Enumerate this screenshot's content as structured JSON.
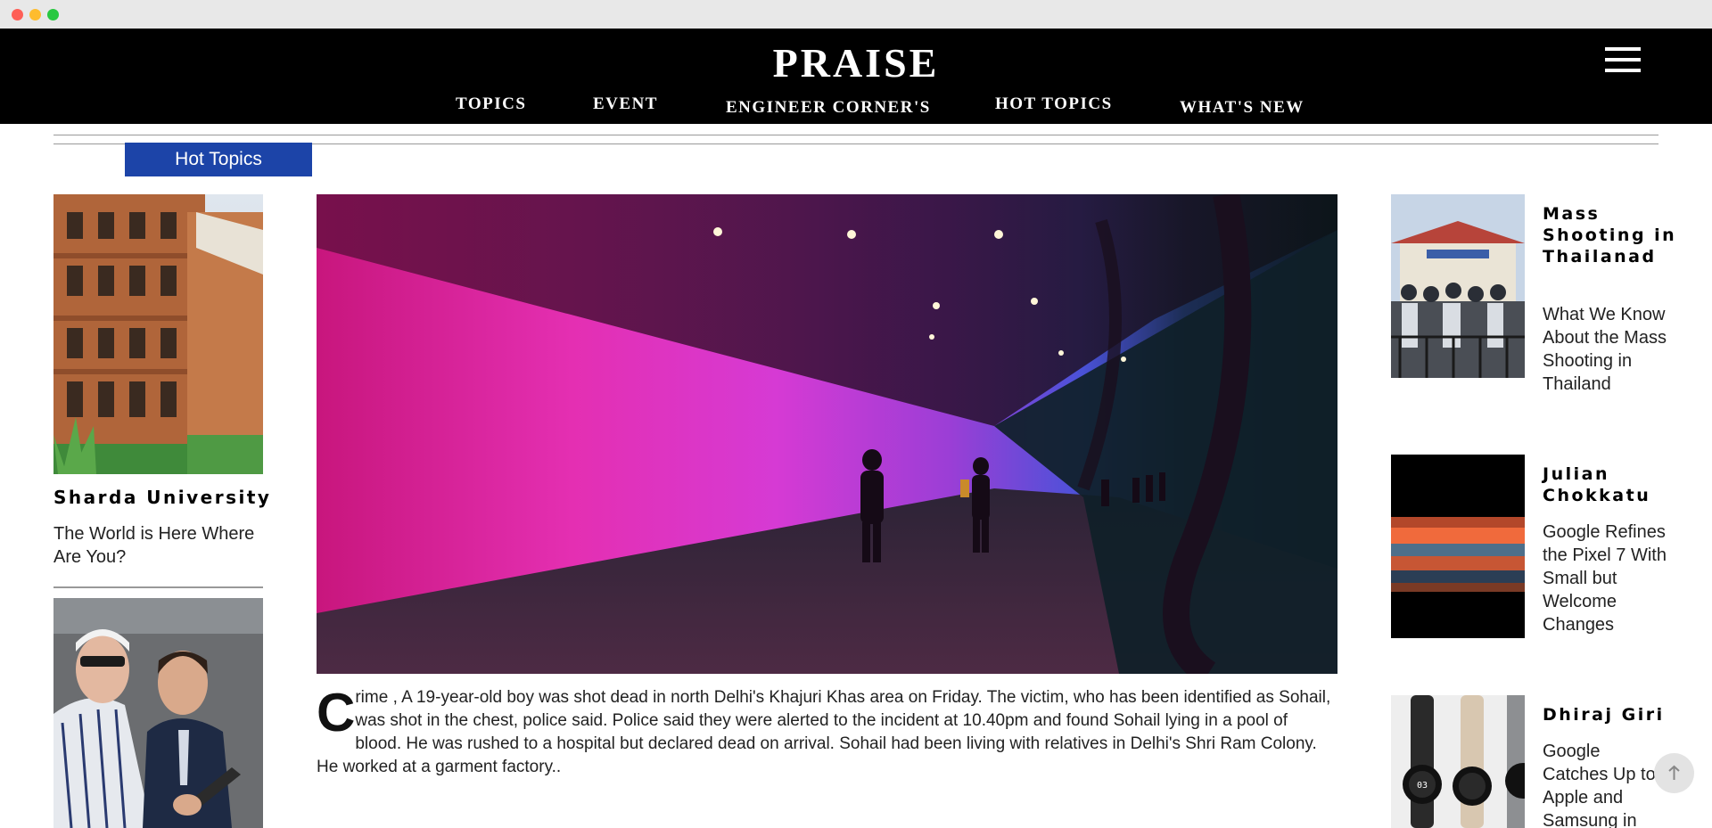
{
  "site": {
    "brand": "PRAISE"
  },
  "nav": {
    "items": [
      "TOPICS",
      "EVENT",
      "ENGINEER CORNER'S",
      "HOT TOPICS",
      "WHAT'S NEW"
    ]
  },
  "section": {
    "tab_label": "Hot Topics"
  },
  "left_column": {
    "items": [
      {
        "title": "Sharda University",
        "subtitle": "The World is Here Where Are You?"
      }
    ]
  },
  "main": {
    "dropcap": "C",
    "article_text": "rime , A 19-year-old boy was shot dead in north Delhi's Khajuri Khas area on Friday. The victim, who has been identified as Sohail, was shot in the chest, police said. Police said they were alerted to the incident at 10.40pm and found Sohail lying in a pool of blood. He was rushed to a hospital but declared dead on arrival. Sohail had been living with relatives in Delhi's Shri Ram Colony. He worked at a garment factory.."
  },
  "right_column": {
    "items": [
      {
        "title": "Mass Shooting in Thailanad",
        "subtitle": "What We Know About the Mass Shooting in Thailand"
      },
      {
        "title": "Julian Chokkatu",
        "subtitle": "Google Refines the Pixel 7 With Small but Welcome Changes"
      },
      {
        "title": "Dhiraj Giri",
        "subtitle": "Google Catches Up to Apple and Samsung in"
      }
    ]
  },
  "icons": {
    "menu": "hamburger-icon",
    "scroll_top": "arrow-up-icon"
  },
  "colors": {
    "header_bg": "#000000",
    "tab_bg": "#1c44a8",
    "accent_magenta": "#e0249a"
  }
}
